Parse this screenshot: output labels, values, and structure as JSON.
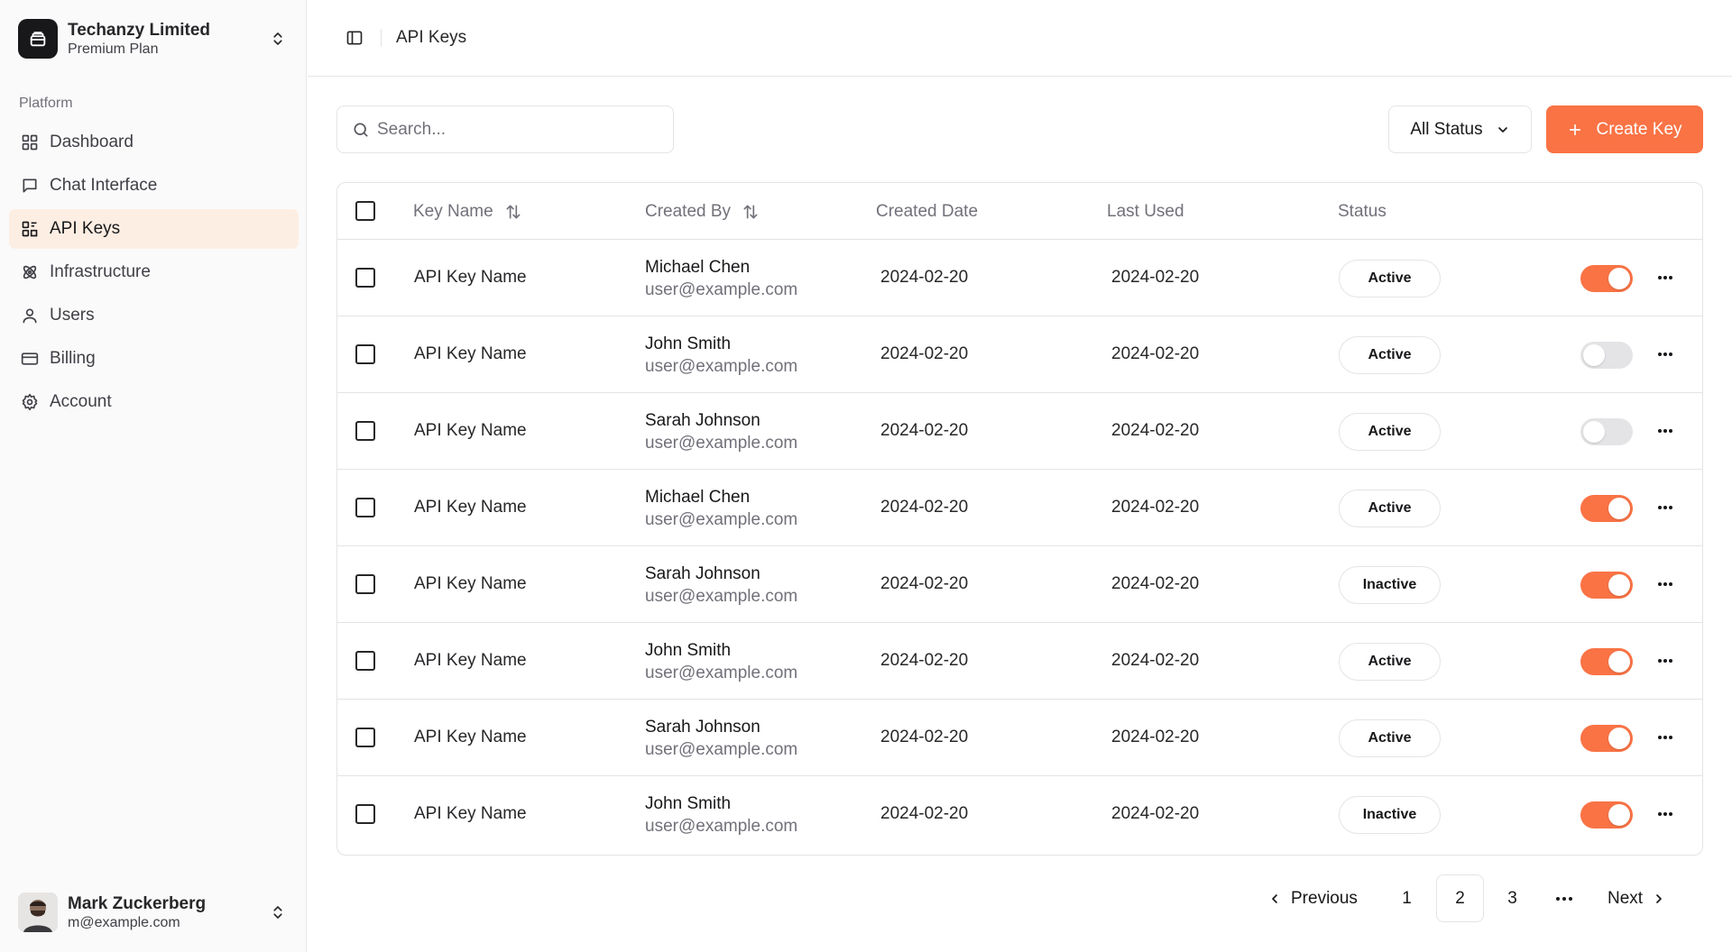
{
  "org": {
    "name": "Techanzy Limited",
    "plan": "Premium Plan"
  },
  "sidebar": {
    "group_label": "Platform",
    "items": [
      {
        "label": "Dashboard",
        "icon": "grid-icon",
        "active": false
      },
      {
        "label": "Chat Interface",
        "icon": "message-square-icon",
        "active": false
      },
      {
        "label": "API Keys",
        "icon": "key-grid-icon",
        "active": true
      },
      {
        "label": "Infrastructure",
        "icon": "atom-icon",
        "active": false
      },
      {
        "label": "Users",
        "icon": "user-icon",
        "active": false
      },
      {
        "label": "Billing",
        "icon": "credit-card-icon",
        "active": false
      },
      {
        "label": "Account",
        "icon": "gear-icon",
        "active": false
      }
    ]
  },
  "user": {
    "name": "Mark Zuckerberg",
    "email": "m@example.com"
  },
  "header": {
    "breadcrumb": "API Keys"
  },
  "toolbar": {
    "search_placeholder": "Search...",
    "status_filter": "All Status",
    "create_label": "Create Key"
  },
  "table": {
    "columns": [
      "Key Name",
      "Created By",
      "Created Date",
      "Last Used",
      "Status"
    ],
    "rows": [
      {
        "key_name": "API Key Name",
        "creator_name": "Michael Chen",
        "creator_email": "user@example.com",
        "created": "2024-02-20",
        "last_used": "2024-02-20",
        "status": "Active",
        "enabled": true
      },
      {
        "key_name": "API Key Name",
        "creator_name": "John Smith",
        "creator_email": "user@example.com",
        "created": "2024-02-20",
        "last_used": "2024-02-20",
        "status": "Active",
        "enabled": false
      },
      {
        "key_name": "API Key Name",
        "creator_name": "Sarah Johnson",
        "creator_email": "user@example.com",
        "created": "2024-02-20",
        "last_used": "2024-02-20",
        "status": "Active",
        "enabled": false
      },
      {
        "key_name": "API Key Name",
        "creator_name": "Michael Chen",
        "creator_email": "user@example.com",
        "created": "2024-02-20",
        "last_used": "2024-02-20",
        "status": "Active",
        "enabled": true
      },
      {
        "key_name": "API Key Name",
        "creator_name": "Sarah Johnson",
        "creator_email": "user@example.com",
        "created": "2024-02-20",
        "last_used": "2024-02-20",
        "status": "Inactive",
        "enabled": true
      },
      {
        "key_name": "API Key Name",
        "creator_name": "John Smith",
        "creator_email": "user@example.com",
        "created": "2024-02-20",
        "last_used": "2024-02-20",
        "status": "Active",
        "enabled": true
      },
      {
        "key_name": "API Key Name",
        "creator_name": "Sarah Johnson",
        "creator_email": "user@example.com",
        "created": "2024-02-20",
        "last_used": "2024-02-20",
        "status": "Active",
        "enabled": true
      },
      {
        "key_name": "API Key Name",
        "creator_name": "John Smith",
        "creator_email": "user@example.com",
        "created": "2024-02-20",
        "last_used": "2024-02-20",
        "status": "Inactive",
        "enabled": true
      }
    ]
  },
  "pagination": {
    "previous_label": "Previous",
    "next_label": "Next",
    "pages": [
      "1",
      "2",
      "3"
    ],
    "current": "2",
    "ellipsis": "..."
  },
  "colors": {
    "accent": "#f97345",
    "active_nav_bg": "#fdeee3",
    "border": "#e4e4e7",
    "muted_text": "#71717a"
  }
}
